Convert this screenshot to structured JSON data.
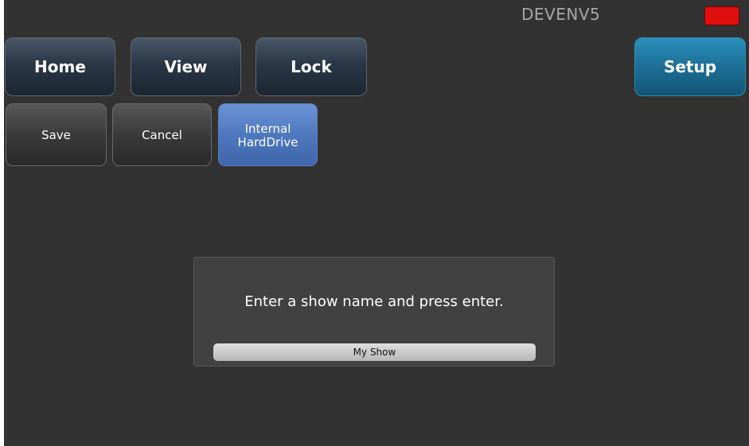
{
  "header": {
    "device_name": "DEVENV5",
    "status_color": "#e01010"
  },
  "nav": {
    "home_label": "Home",
    "view_label": "View",
    "lock_label": "Lock",
    "setup_label": "Setup"
  },
  "actions": {
    "save_label": "Save",
    "cancel_label": "Cancel",
    "drive_label_line1": "Internal",
    "drive_label_line2": "HardDrive"
  },
  "dialog": {
    "prompt": "Enter a show name and press enter.",
    "show_name_value": "My Show"
  }
}
